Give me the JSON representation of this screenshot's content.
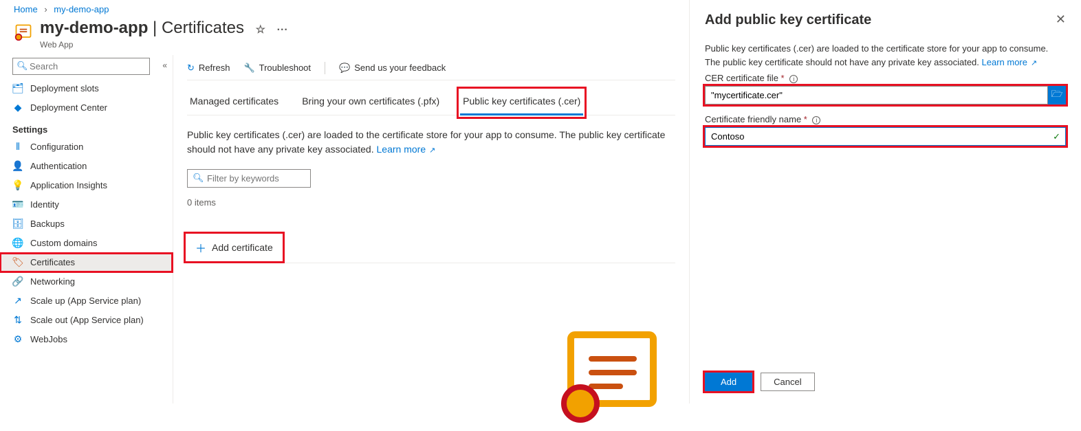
{
  "breadcrumbs": {
    "home": "Home",
    "app": "my-demo-app"
  },
  "header": {
    "appName": "my-demo-app",
    "separator": " | ",
    "section": "Certificates",
    "subtitle": "Web App",
    "star": "☆",
    "more": "···"
  },
  "sidebar": {
    "search_placeholder": "Search",
    "collapse": "«",
    "items_top": [
      {
        "icon": "deployment-slots-icon",
        "glyph": "🗂",
        "color": "#0078d4",
        "label": "Deployment slots"
      },
      {
        "icon": "deployment-center-icon",
        "glyph": "◆",
        "color": "#0078d4",
        "label": "Deployment Center"
      }
    ],
    "section": "Settings",
    "items": [
      {
        "icon": "configuration-icon",
        "glyph": "⦀",
        "color": "#0078d4",
        "label": "Configuration"
      },
      {
        "icon": "authentication-icon",
        "glyph": "👤",
        "color": "#0078d4",
        "label": "Authentication"
      },
      {
        "icon": "app-insights-icon",
        "glyph": "💡",
        "color": "#8661c5",
        "label": "Application Insights"
      },
      {
        "icon": "identity-icon",
        "glyph": "🪪",
        "color": "#0078d4",
        "label": "Identity"
      },
      {
        "icon": "backups-icon",
        "glyph": "🗄",
        "color": "#0078d4",
        "label": "Backups"
      },
      {
        "icon": "custom-domains-icon",
        "glyph": "🌐",
        "color": "#0078d4",
        "label": "Custom domains"
      },
      {
        "icon": "certificates-icon",
        "glyph": "🏷",
        "color": "#ca5010",
        "label": "Certificates",
        "active": true
      },
      {
        "icon": "networking-icon",
        "glyph": "🔗",
        "color": "#0078d4",
        "label": "Networking"
      },
      {
        "icon": "scale-up-icon",
        "glyph": "↗",
        "color": "#0078d4",
        "label": "Scale up (App Service plan)"
      },
      {
        "icon": "scale-out-icon",
        "glyph": "⇅",
        "color": "#0078d4",
        "label": "Scale out (App Service plan)"
      },
      {
        "icon": "webjobs-icon",
        "glyph": "⚙",
        "color": "#0078d4",
        "label": "WebJobs"
      }
    ]
  },
  "toolbar": {
    "refresh": "Refresh",
    "troubleshoot": "Troubleshoot",
    "feedback": "Send us your feedback"
  },
  "tabs": {
    "managed": "Managed certificates",
    "byoc": "Bring your own certificates (.pfx)",
    "pubkey": "Public key certificates (.cer)"
  },
  "main": {
    "desc": "Public key certificates (.cer) are loaded to the certificate store for your app to consume. The public key certificate should not have any private key associated. ",
    "learn_more": "Learn more",
    "filter_placeholder": "Filter by keywords",
    "item_count": "0 items",
    "add_cert": "Add certificate"
  },
  "panel": {
    "title": "Add public key certificate",
    "desc": "Public key certificates (.cer) are loaded to the certificate store for your app to consume. The public key certificate should not have any private key associated. ",
    "learn_more": "Learn more",
    "file_label": "CER certificate file",
    "file_value": "\"mycertificate.cer\"",
    "name_label": "Certificate friendly name",
    "name_value": "Contoso",
    "add": "Add",
    "cancel": "Cancel"
  }
}
